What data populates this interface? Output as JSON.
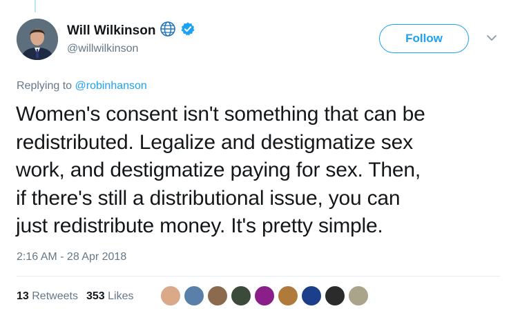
{
  "user": {
    "name": "Will Wilkinson",
    "handle": "@willwilkinson",
    "globe_icon": "globe-icon",
    "verified_icon": "verified-badge-icon"
  },
  "follow_label": "Follow",
  "reply": {
    "prefix": "Replying to",
    "mention": "@robinhanson"
  },
  "tweet_lines": [
    "Women's consent isn't something that can be",
    "redistributed. Legalize and destigmatize sex",
    "work, and destigmatize paying for sex. Then,",
    "if there's still a distributional issue, you can",
    "just redistribute money. It's pretty simple."
  ],
  "timestamp": "2:16 AM - 28 Apr 2018",
  "stats": {
    "retweets_count": "13",
    "retweets_label": "Retweets",
    "likes_count": "353",
    "likes_label": "Likes"
  },
  "liker_colors": [
    "#d9a98a",
    "#5a7fa8",
    "#8c6a4e",
    "#3b4a3a",
    "#8a1f8a",
    "#b07a3a",
    "#1b3f8a",
    "#2b2b2b",
    "#a9a48a"
  ],
  "colors": {
    "accent": "#1da1f2",
    "text": "#14171a",
    "muted": "#657786"
  }
}
